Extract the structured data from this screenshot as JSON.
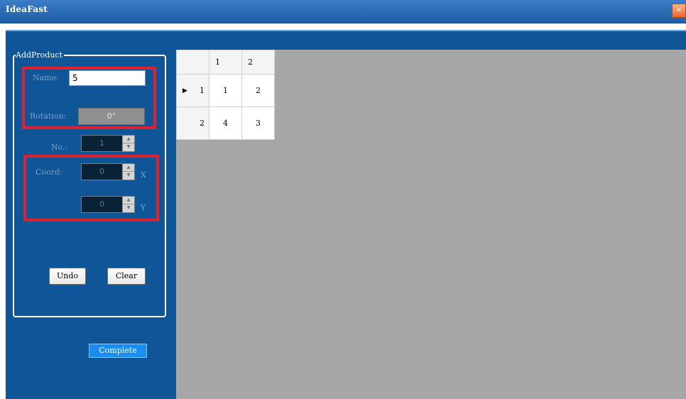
{
  "window": {
    "title": "IdeaFast",
    "close_glyph": "×"
  },
  "groupbox": {
    "title": "AddProduct"
  },
  "form": {
    "name_label": "Name:",
    "name_value": "5",
    "rotation_label": "Rotation:",
    "rotation_value": "0°",
    "no_label": "No.:",
    "no_value": "1",
    "coord_label": "Coord:",
    "coord_x_value": "0",
    "coord_y_value": "0",
    "x_axis_label": "X",
    "y_axis_label": "Y",
    "spin_up": "▲",
    "spin_down": "▼"
  },
  "buttons": {
    "undo": "Undo",
    "clear": "Clear",
    "complete": "Complete"
  },
  "grid": {
    "column_headers": [
      "1",
      "2"
    ],
    "rows": [
      {
        "header": "1",
        "cells": [
          "1",
          "2"
        ],
        "selected": true
      },
      {
        "header": "2",
        "cells": [
          "4",
          "3"
        ],
        "selected": false
      }
    ],
    "selected_row_marker": "▶"
  },
  "colors": {
    "panel_bg": "#0f5699",
    "highlight_red": "#e0212e",
    "canvas_bg": "#a7a7a7",
    "complete_button": "#1a8df0"
  }
}
